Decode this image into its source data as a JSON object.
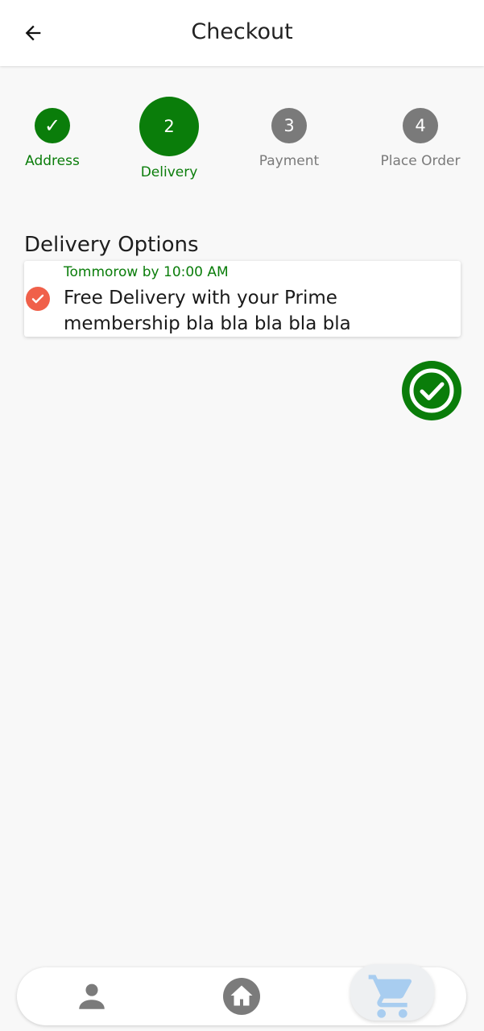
{
  "appbar": {
    "title": "Checkout",
    "back_icon": "arrow-left-icon"
  },
  "stepper": {
    "steps": [
      {
        "number": "1",
        "label": "Address",
        "status": "done",
        "mark": "✓"
      },
      {
        "number": "2",
        "label": "Delivery",
        "status": "active"
      },
      {
        "number": "3",
        "label": "Payment",
        "status": "pending"
      },
      {
        "number": "4",
        "label": "Place Order",
        "status": "pending"
      }
    ]
  },
  "delivery": {
    "section_title": "Delivery Options",
    "options": [
      {
        "eta": "Tommorow by 10:00 AM",
        "description": "Free Delivery with your Prime membership bla bla bla bla bla",
        "selected": true
      }
    ],
    "confirm_icon": "check-circle-icon"
  },
  "bottom_nav": {
    "items": [
      {
        "icon": "person-icon",
        "active": false
      },
      {
        "icon": "home-icon",
        "active": false
      },
      {
        "icon": "cart-icon",
        "active": true
      }
    ]
  },
  "colors": {
    "primary_green": "#0a7d0a",
    "pending_gray": "#7a7a7a",
    "radio_selected": "#f0604a",
    "cart_active": "#a8cdf0",
    "background": "#f8f8f8"
  }
}
